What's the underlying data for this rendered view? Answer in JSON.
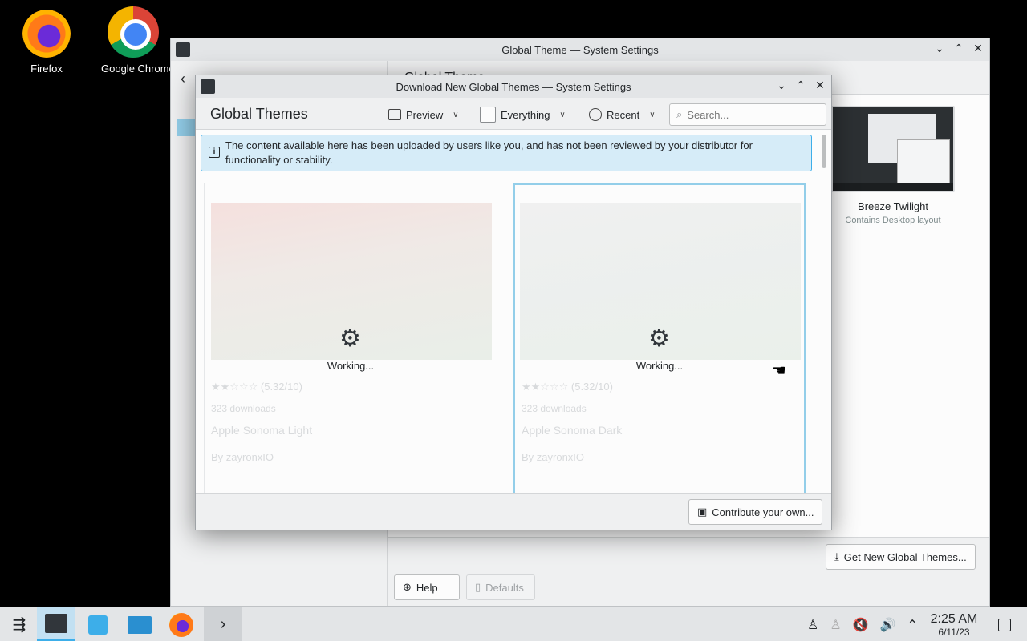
{
  "desktop": {
    "icons": [
      {
        "label": "Firefox"
      },
      {
        "label": "Google Chrome"
      }
    ]
  },
  "bg_window": {
    "title": "Global Theme — System Settings",
    "header_title": "Global Theme",
    "theme_card": {
      "name": "Breeze Twilight",
      "subtitle": "Contains Desktop layout"
    },
    "get_new_button": "Get New Global Themes...",
    "help_button": "Help",
    "defaults_button": "Defaults"
  },
  "dialog": {
    "title": "Download New Global Themes — System Settings",
    "heading": "Global Themes",
    "toolbar": {
      "preview_label": "Preview",
      "filter_label": "Everything",
      "sort_label": "Recent",
      "search_placeholder": "Search..."
    },
    "notice": "The content available here has been uploaded by users like you, and has not been reviewed by your distributor for functionality or stability.",
    "cards": [
      {
        "rating_text": "(5.32/10)",
        "reviews": "323 downloads",
        "name": "Apple Sonoma Light",
        "author": "By zayronxIO",
        "status": "Working...",
        "rating": 0.53
      },
      {
        "rating_text": "(5.32/10)",
        "reviews": "323 downloads",
        "name": "Apple Sonoma Dark",
        "author": "By zayronxIO",
        "status": "Working...",
        "rating": 0.5
      }
    ],
    "contribute_button": "Contribute your own..."
  },
  "taskbar": {
    "time": "2:25 AM",
    "date": "6/11/23"
  },
  "colors": {
    "accent": "#3daee9",
    "selection": "#93cee9",
    "notice_bg": "#d6ecf8"
  }
}
